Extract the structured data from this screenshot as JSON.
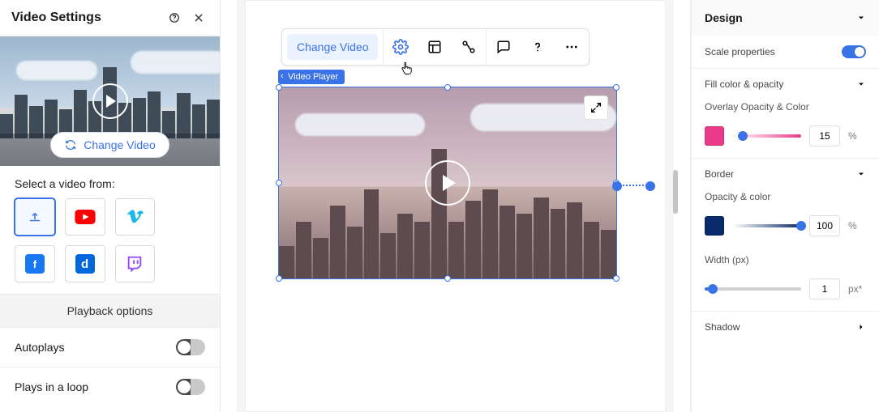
{
  "left": {
    "title": "Video Settings",
    "change_video": "Change Video",
    "select_label": "Select a video from:",
    "sources": [
      {
        "id": "upload",
        "label": "Upload"
      },
      {
        "id": "youtube",
        "label": "YouTube"
      },
      {
        "id": "vimeo",
        "label": "Vimeo"
      },
      {
        "id": "facebook",
        "label": "Facebook"
      },
      {
        "id": "dailymotion",
        "label": "Dailymotion"
      },
      {
        "id": "twitch",
        "label": "Twitch"
      }
    ],
    "playback_header": "Playback options",
    "autoplay_label": "Autoplays",
    "loop_label": "Plays in a loop"
  },
  "canvas": {
    "toolbar": {
      "change_video": "Change Video"
    },
    "element_tag": "Video Player"
  },
  "design": {
    "title": "Design",
    "scale_label": "Scale properties",
    "scale_on": true,
    "fill_header": "Fill color & opacity",
    "overlay_label": "Overlay Opacity & Color",
    "overlay_color": "#ec3a8b",
    "overlay_opacity": "15",
    "overlay_unit": "%",
    "border_header": "Border",
    "border_opacity_label": "Opacity & color",
    "border_color": "#0b2a6b",
    "border_opacity": "100",
    "border_unit": "%",
    "width_label": "Width (px)",
    "width_value": "1",
    "width_unit": "px*",
    "shadow_header": "Shadow"
  }
}
